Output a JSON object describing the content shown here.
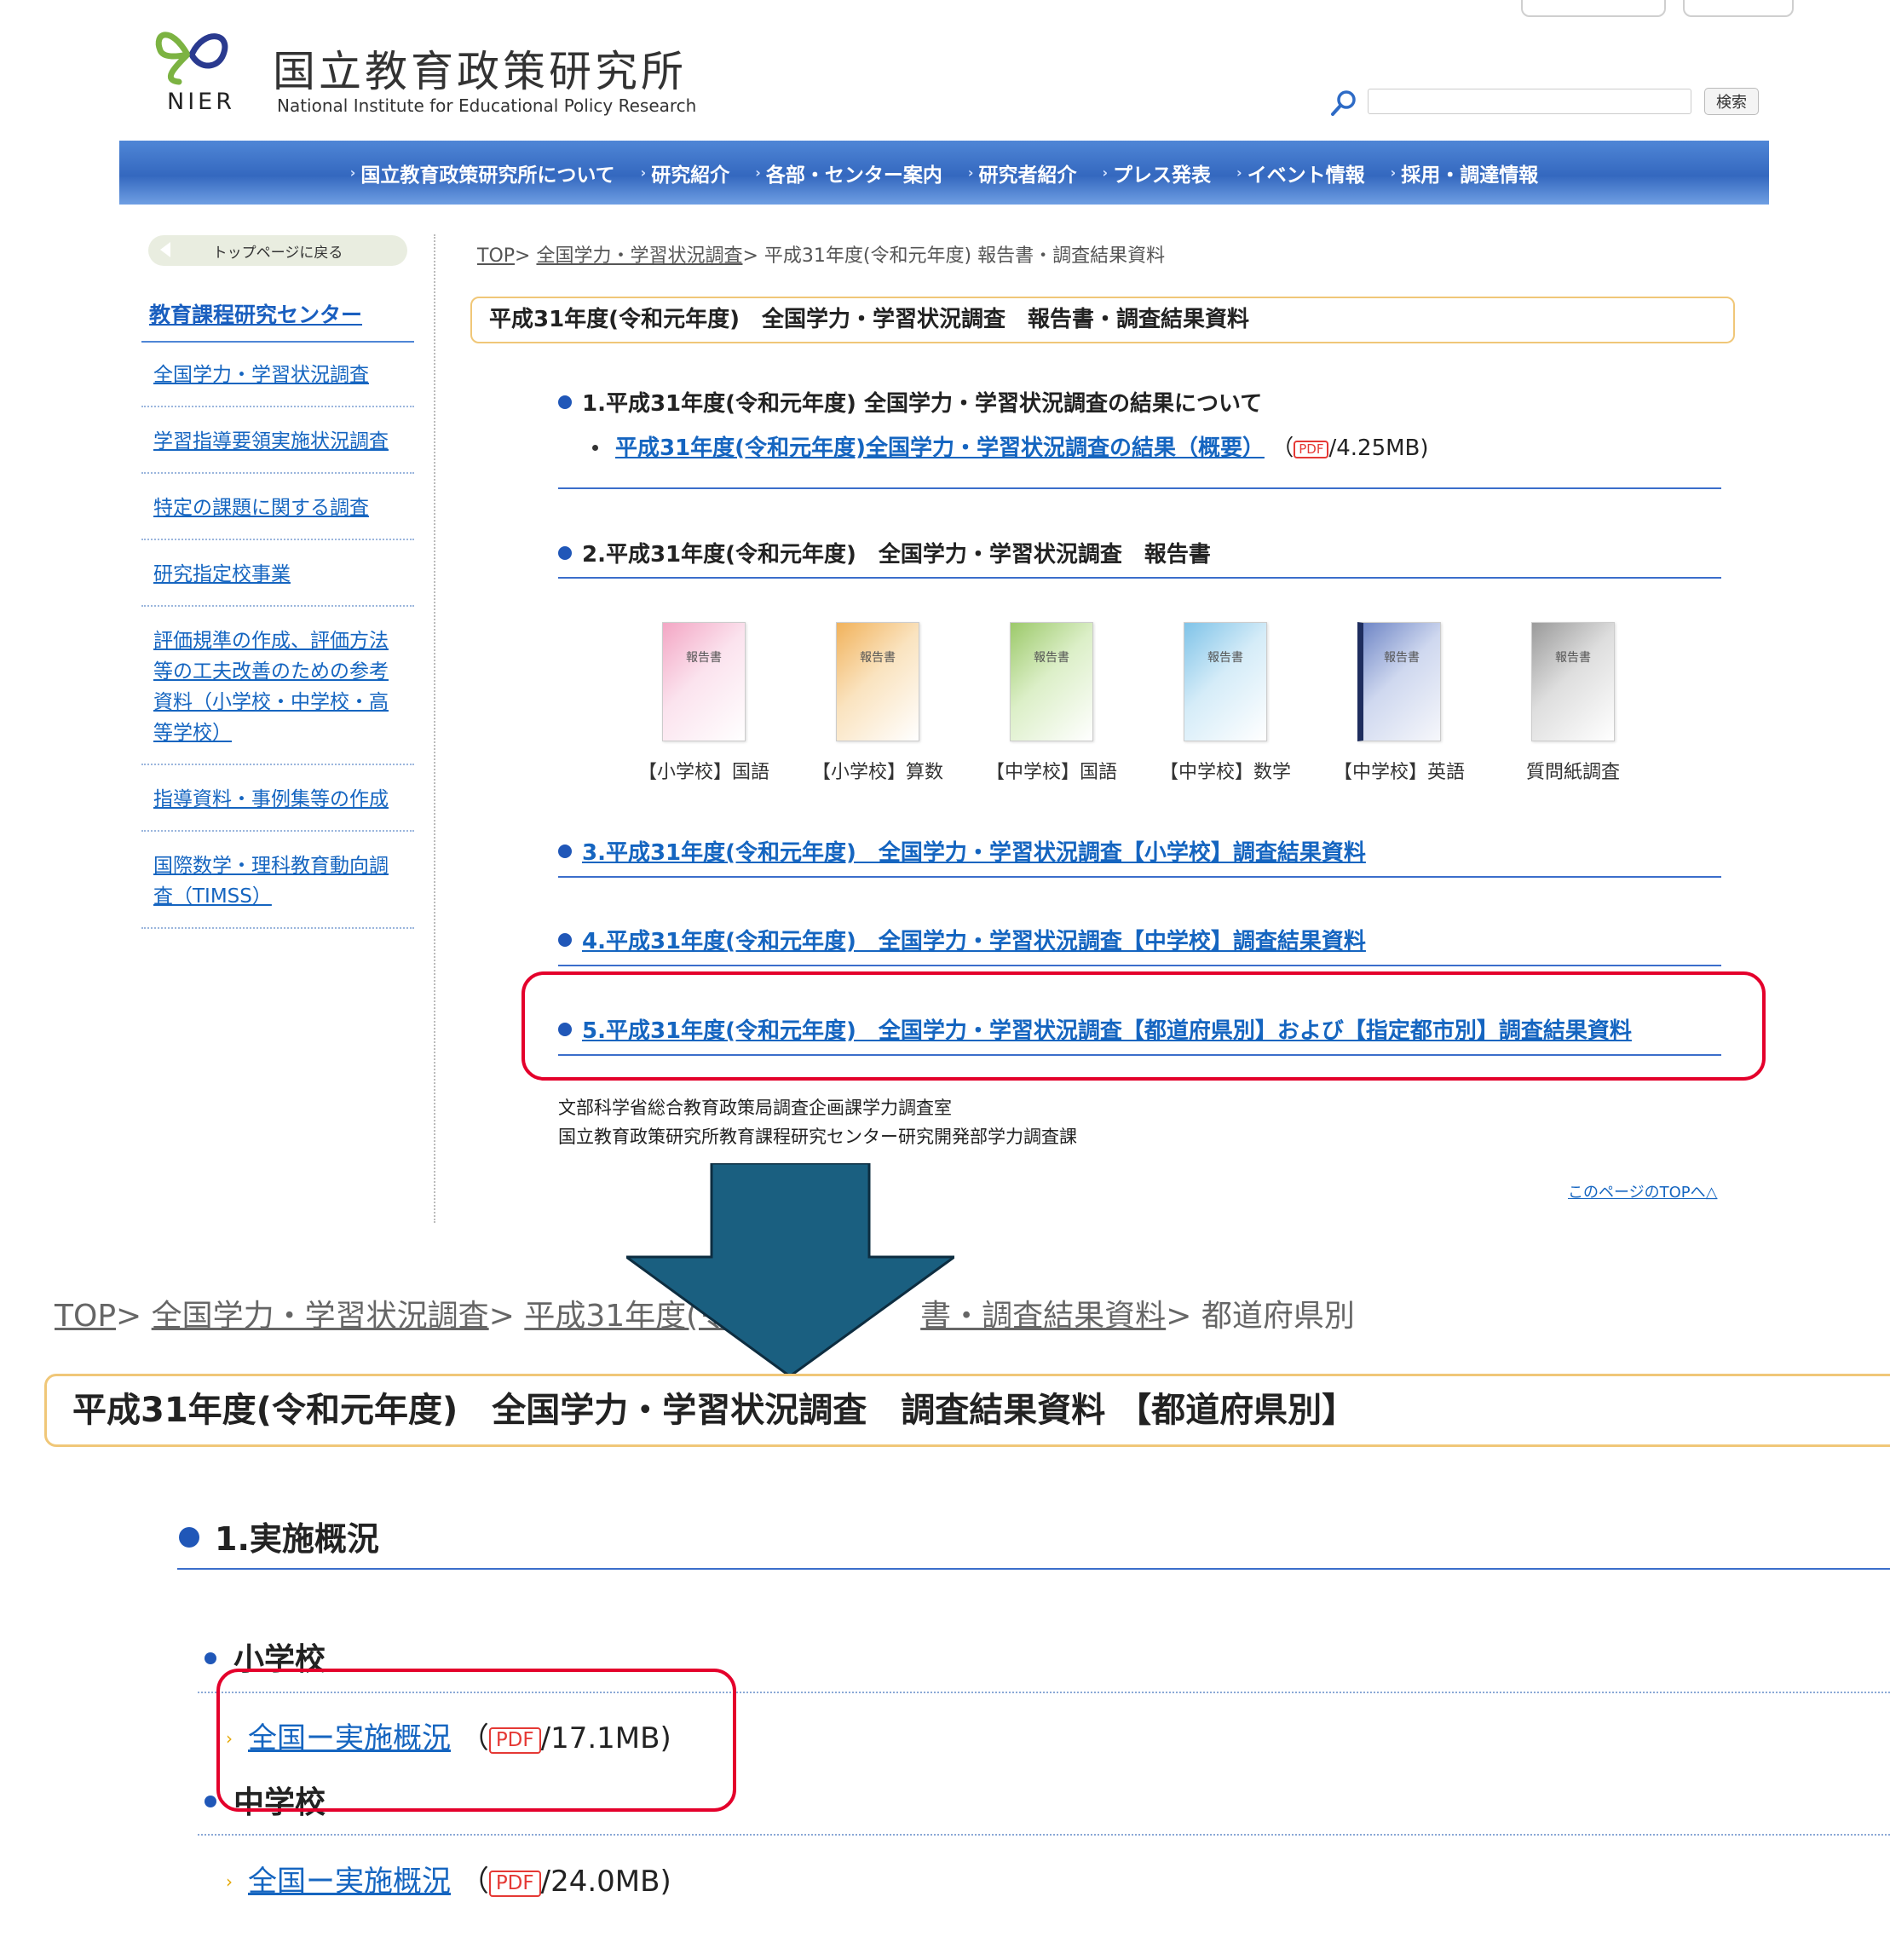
{
  "header": {
    "org_name_ja": "国立教育政策研究所",
    "logo_text": "NIER",
    "org_name_en": "National Institute for Educational Policy Research",
    "search_button_label": "検索"
  },
  "nav": [
    "国立教育政策研究所について",
    "研究紹介",
    "各部・センター案内",
    "研究者紹介",
    "プレス発表",
    "イベント情報",
    "採用・調達情報"
  ],
  "sidebar": {
    "back_button_label": "トップページに戻る",
    "title": "教育課程研究センター",
    "items": [
      "全国学力・学習状況調査",
      "学習指導要領実施状況調査",
      "特定の課題に関する調査",
      "研究指定校事業",
      "評価規準の作成、評価方法等の工夫改善のための参考資料（小学校・中学校・高等学校）",
      "指導資料・事例集等の作成",
      "国際数学・理科教育動向調査（TIMSS）"
    ]
  },
  "top_page": {
    "breadcrumb": {
      "top": "TOP",
      "survey": "全国学力・学習状況調査",
      "current": "平成31年度(令和元年度) 報告書・調査結果資料",
      "sep": ">"
    },
    "title": "平成31年度(令和元年度)　全国学力・学習状況調査　報告書・調査結果資料",
    "section1": {
      "heading": "1.平成31年度(令和元年度) 全国学力・学習状況調査の結果について",
      "link": "平成31年度(令和元年度)全国学力・学習状況調査の結果（概要）",
      "open_paren": "（",
      "pdf_label": "PDF",
      "size": "/4.25MB)"
    },
    "section2_heading": "2.平成31年度(令和元年度)　全国学力・学習状況調査　報告書",
    "cover_label": "報告書",
    "reports": [
      {
        "caption": "【小学校】国語",
        "color": "#f3a6c4"
      },
      {
        "caption": "【小学校】算数",
        "color": "#f1b25b"
      },
      {
        "caption": "【中学校】国語",
        "color": "#9cc96a"
      },
      {
        "caption": "【中学校】数学",
        "color": "#7fc3e8"
      },
      {
        "caption": "【中学校】英語",
        "color": "#6f86c6"
      },
      {
        "caption": "質問紙調査",
        "color": "#9a9a9a"
      }
    ],
    "section3_link": "3.平成31年度(令和元年度)　全国学力・学習状況調査【小学校】調査結果資料",
    "section4_link": "4.平成31年度(令和元年度)　全国学力・学習状況調査【中学校】調査結果資料",
    "section5_link": "5.平成31年度(令和元年度)　全国学力・学習状況調査【都道府県別】および【指定都市別】調査結果資料",
    "footer_line1": "文部科学省総合教育政策局調査企画課学力調査室",
    "footer_line2": "国立教育政策研究所教育課程研究センター研究開発部学力調査課",
    "page_top_link": "このページのTOPへ△"
  },
  "bottom_page": {
    "breadcrumb": {
      "top": "TOP",
      "survey": "全国学力・学習状況調査",
      "year_left": "平成31年度(令",
      "year_right": "書・調査結果資料",
      "current": "都道府県別",
      "sep": ">"
    },
    "title": "平成31年度(令和元年度)　全国学力・学習状況調査　調査結果資料 【都道府県別】",
    "section_heading": "1.実施概況",
    "elementary_heading": "小学校",
    "elementary_link": "全国ー実施概況",
    "elementary_open": "（",
    "elementary_size": "/17.1MB)",
    "junior_heading": "中学校",
    "junior_link": "全国ー実施概況",
    "junior_open": "（",
    "junior_size": "/24.0MB)",
    "pdf_label": "PDF"
  },
  "colors": {
    "nav_blue": "#3468bf",
    "link_blue": "#1565c0",
    "highlight_red": "#e4002b",
    "arrow_fill": "#1a5f80",
    "title_border": "#f0c778"
  }
}
